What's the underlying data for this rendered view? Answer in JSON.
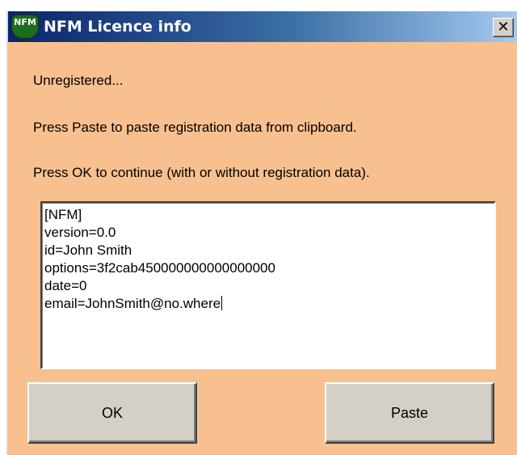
{
  "window": {
    "title": "NFM Licence info",
    "icon_text": "NFM",
    "close_glyph": "✕"
  },
  "messages": {
    "status": "Unregistered...",
    "paste_hint": "Press Paste to paste registration data from clipboard.",
    "ok_hint": "Press OK to continue (with or without registration data)."
  },
  "registration": {
    "lines": [
      "[NFM]",
      "version=0.0",
      "id=John Smith",
      "options=3f2cab450000000000000000",
      "date=0",
      "email=JohnSmith@no.where"
    ]
  },
  "buttons": {
    "ok_label": "OK",
    "paste_label": "Paste"
  },
  "colors": {
    "dialog_background": "#f8c08e",
    "titlebar_start": "#0a246a",
    "titlebar_end": "#a6caf0",
    "button_face": "#d4d0c8"
  }
}
